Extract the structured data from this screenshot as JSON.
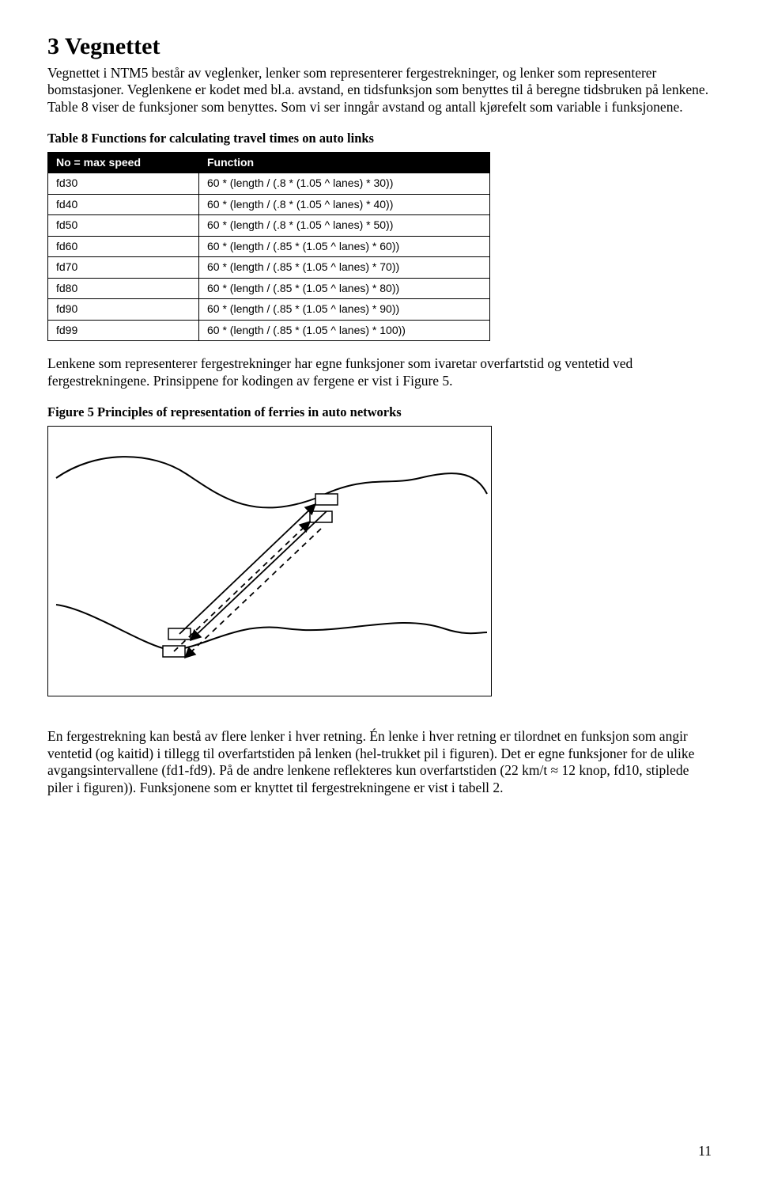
{
  "section": {
    "heading": "3 Vegnettet",
    "p1": "Vegnettet i NTM5 består av veglenker, lenker som representerer fergestrekninger, og lenker som representerer bomstasjoner. Veglenkene er kodet med bl.a. avstand, en tidsfunksjon som benyttes til å beregne tidsbruken på lenkene. Table 8 viser de funksjoner som benyttes. Som vi ser inngår avstand og antall kjørefelt som variable i funksjonene.",
    "table8_caption": "Table 8 Functions for calculating travel times on auto links",
    "table8_head_no": "No = max speed",
    "table8_head_fn": "Function",
    "table8_rows": [
      {
        "no": "fd30",
        "fn": "60 * (length / (.8 * (1.05 ^ lanes) * 30))"
      },
      {
        "no": "fd40",
        "fn": "60 * (length / (.8 * (1.05 ^ lanes) * 40))"
      },
      {
        "no": "fd50",
        "fn": "60 * (length / (.8 * (1.05 ^ lanes) * 50))"
      },
      {
        "no": "fd60",
        "fn": "60 * (length / (.85 * (1.05 ^ lanes) * 60))"
      },
      {
        "no": "fd70",
        "fn": "60 * (length / (.85 * (1.05 ^ lanes) * 70))"
      },
      {
        "no": "fd80",
        "fn": "60 * (length / (.85 * (1.05 ^ lanes) * 80))"
      },
      {
        "no": "fd90",
        "fn": "60 * (length / (.85 * (1.05 ^ lanes) * 90))"
      },
      {
        "no": "fd99",
        "fn": "60 * (length / (.85 * (1.05 ^ lanes) * 100))"
      }
    ],
    "p2": "Lenkene som representerer fergestrekninger har egne funksjoner som ivaretar overfartstid og ventetid ved fergestrekningene. Prinsippene for kodingen av fergene er vist i Figure 5.",
    "fig5_caption": "Figure 5 Principles of representation of ferries in auto networks",
    "p3": "En fergestrekning kan bestå av flere lenker i hver retning. Én lenke i hver retning er tilordnet en funksjon som angir ventetid (og kaitid) i tillegg til overfartstiden på lenken (hel-trukket pil i figuren). Det er egne funksjoner for de ulike avgangsintervallene (fd1-fd9). På de andre lenkene reflekteres kun overfartstiden (22 km/t ≈ 12 knop, fd10, stiplede piler i figuren)). Funksjonene som er knyttet til fergestrekningene er vist i tabell 2."
  },
  "page_number": "11"
}
